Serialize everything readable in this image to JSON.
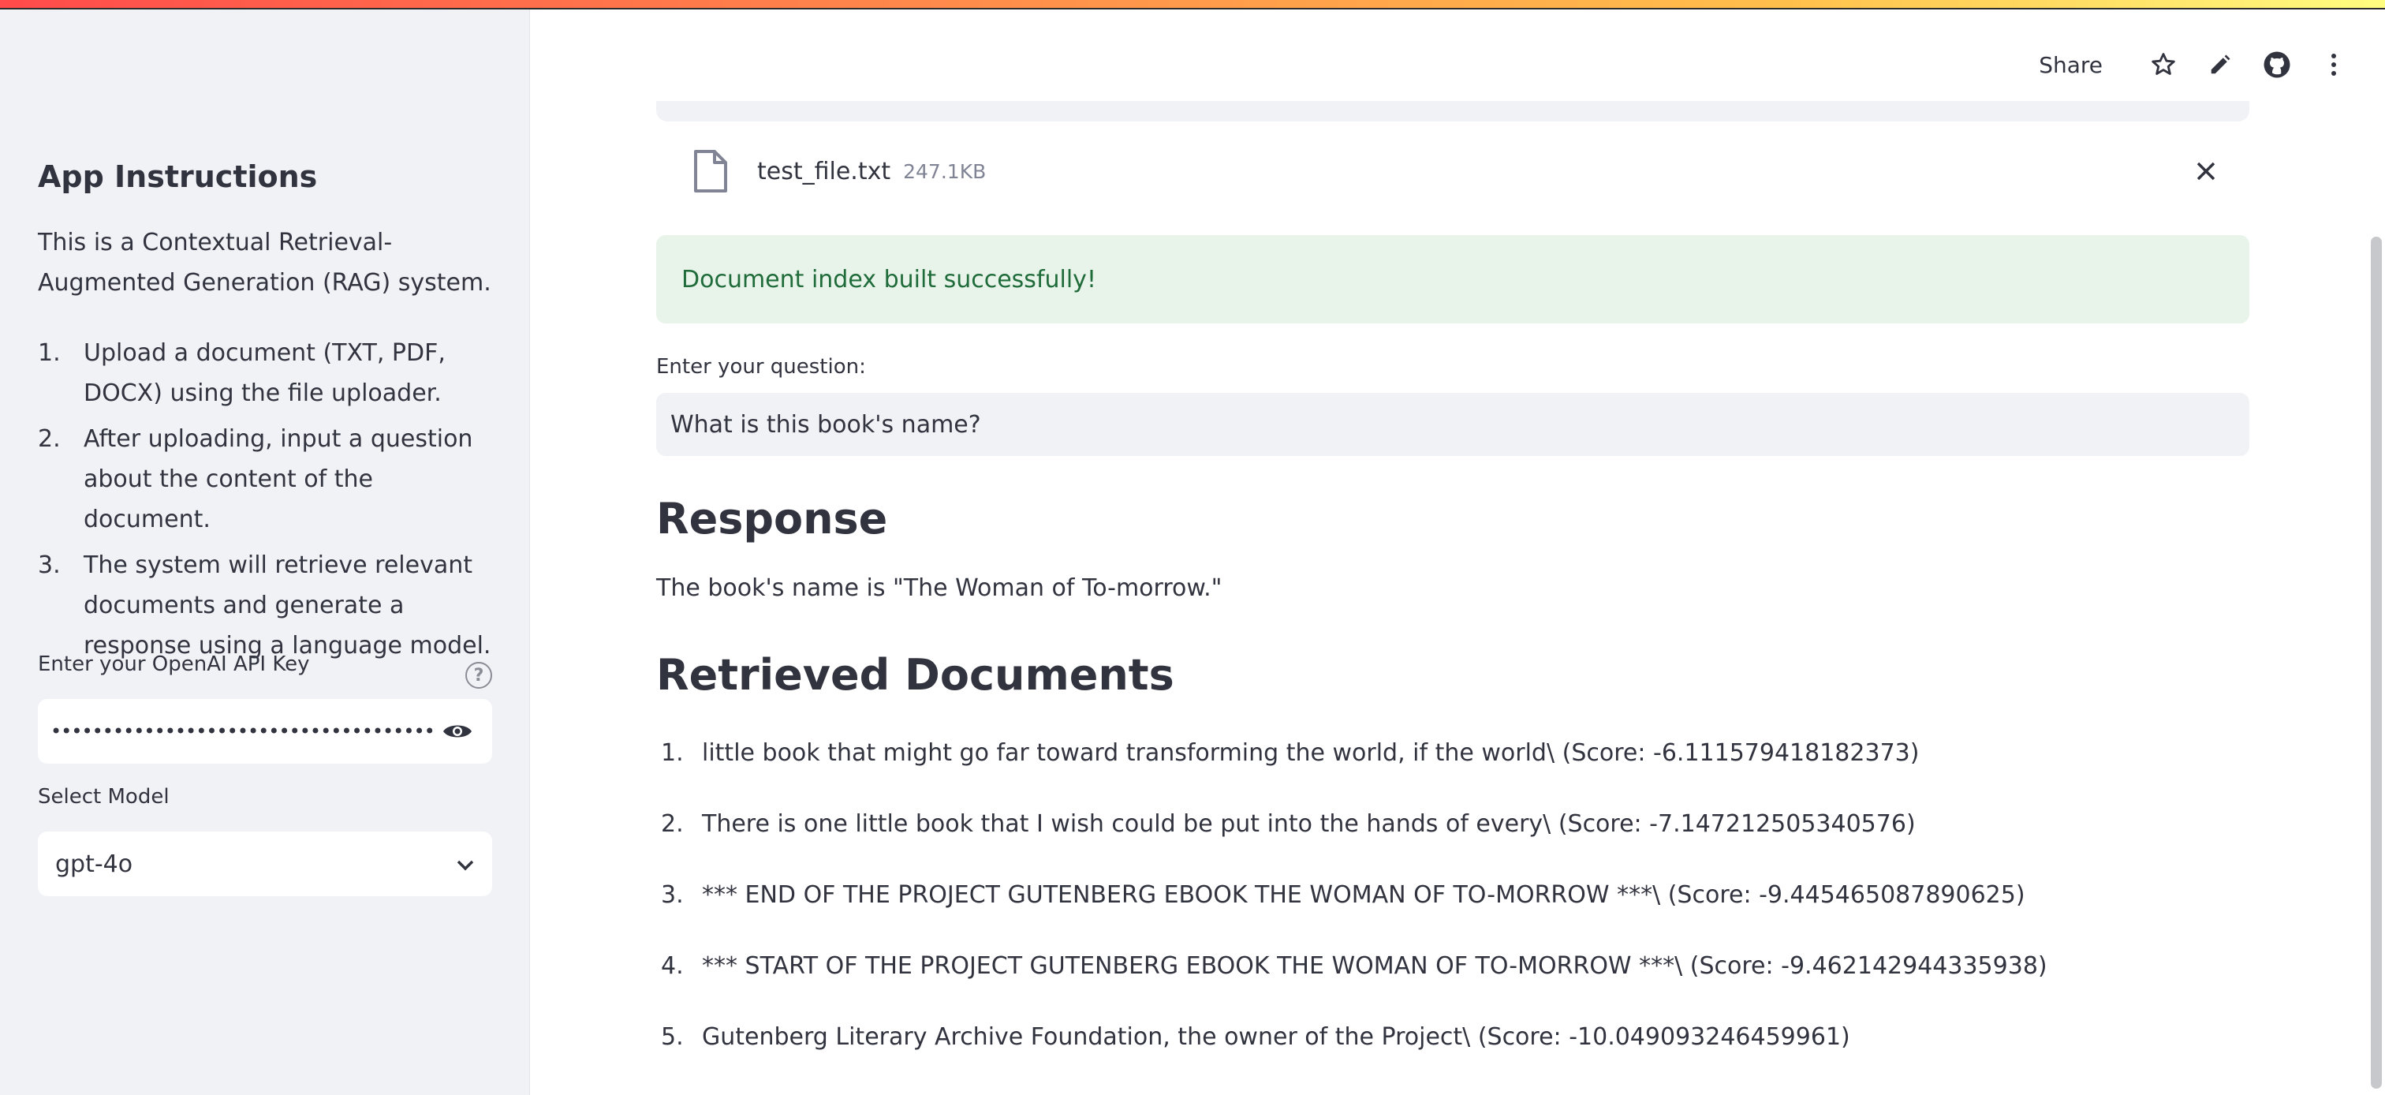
{
  "sidebar": {
    "title": "App Instructions",
    "description": "This is a Contextual Retrieval-Augmented Generation (RAG) system.",
    "steps": [
      {
        "num": "1.",
        "text": "Upload a document (TXT, PDF, DOCX) using the file uploader."
      },
      {
        "num": "2.",
        "text": "After uploading, input a question about the content of the document."
      },
      {
        "num": "3.",
        "text": "The system will retrieve relevant documents and generate a response using a language model."
      }
    ],
    "api_key_label": "Enter your OpenAI API Key",
    "help_icon": "?",
    "api_key_masked": "••••••••••••••••••••••••••••••••••••••••••••••••••••••",
    "model_label": "Select Model",
    "model_value": "gpt-4o"
  },
  "header": {
    "share_label": "Share",
    "icons": [
      "star-icon",
      "edit-icon",
      "github-icon",
      "more-icon"
    ]
  },
  "main": {
    "file": {
      "name": "test_file.txt",
      "size": "247.1KB"
    },
    "success_message": "Document index built successfully!",
    "question_label": "Enter your question:",
    "question_value": "What is this book's name?",
    "response_heading": "Response",
    "response_text": "The book's name is \"The Woman of To-morrow.\"",
    "docs_heading": "Retrieved Documents",
    "documents": [
      {
        "num": "1.",
        "text": "little book that might go far toward transforming the world, if the world\\ (Score: -6.111579418182373)"
      },
      {
        "num": "2.",
        "text": "There is one little book that I wish could be put into the hands of every\\ (Score: -7.147212505340576)"
      },
      {
        "num": "3.",
        "text": "*** END OF THE PROJECT GUTENBERG EBOOK THE WOMAN OF TO-MORROW ***\\ (Score: -9.445465087890625)"
      },
      {
        "num": "4.",
        "text": "*** START OF THE PROJECT GUTENBERG EBOOK THE WOMAN OF TO-MORROW ***\\ (Score: -9.462142944335938)"
      },
      {
        "num": "5.",
        "text": "Gutenberg Literary Archive Foundation, the owner of the Project\\ (Score: -10.049093246459961)"
      }
    ]
  },
  "colors": {
    "sidebar_bg": "#f0f2f6",
    "success_bg": "#e8f4ea",
    "success_text": "#1f6b3a",
    "text": "#31333f"
  }
}
